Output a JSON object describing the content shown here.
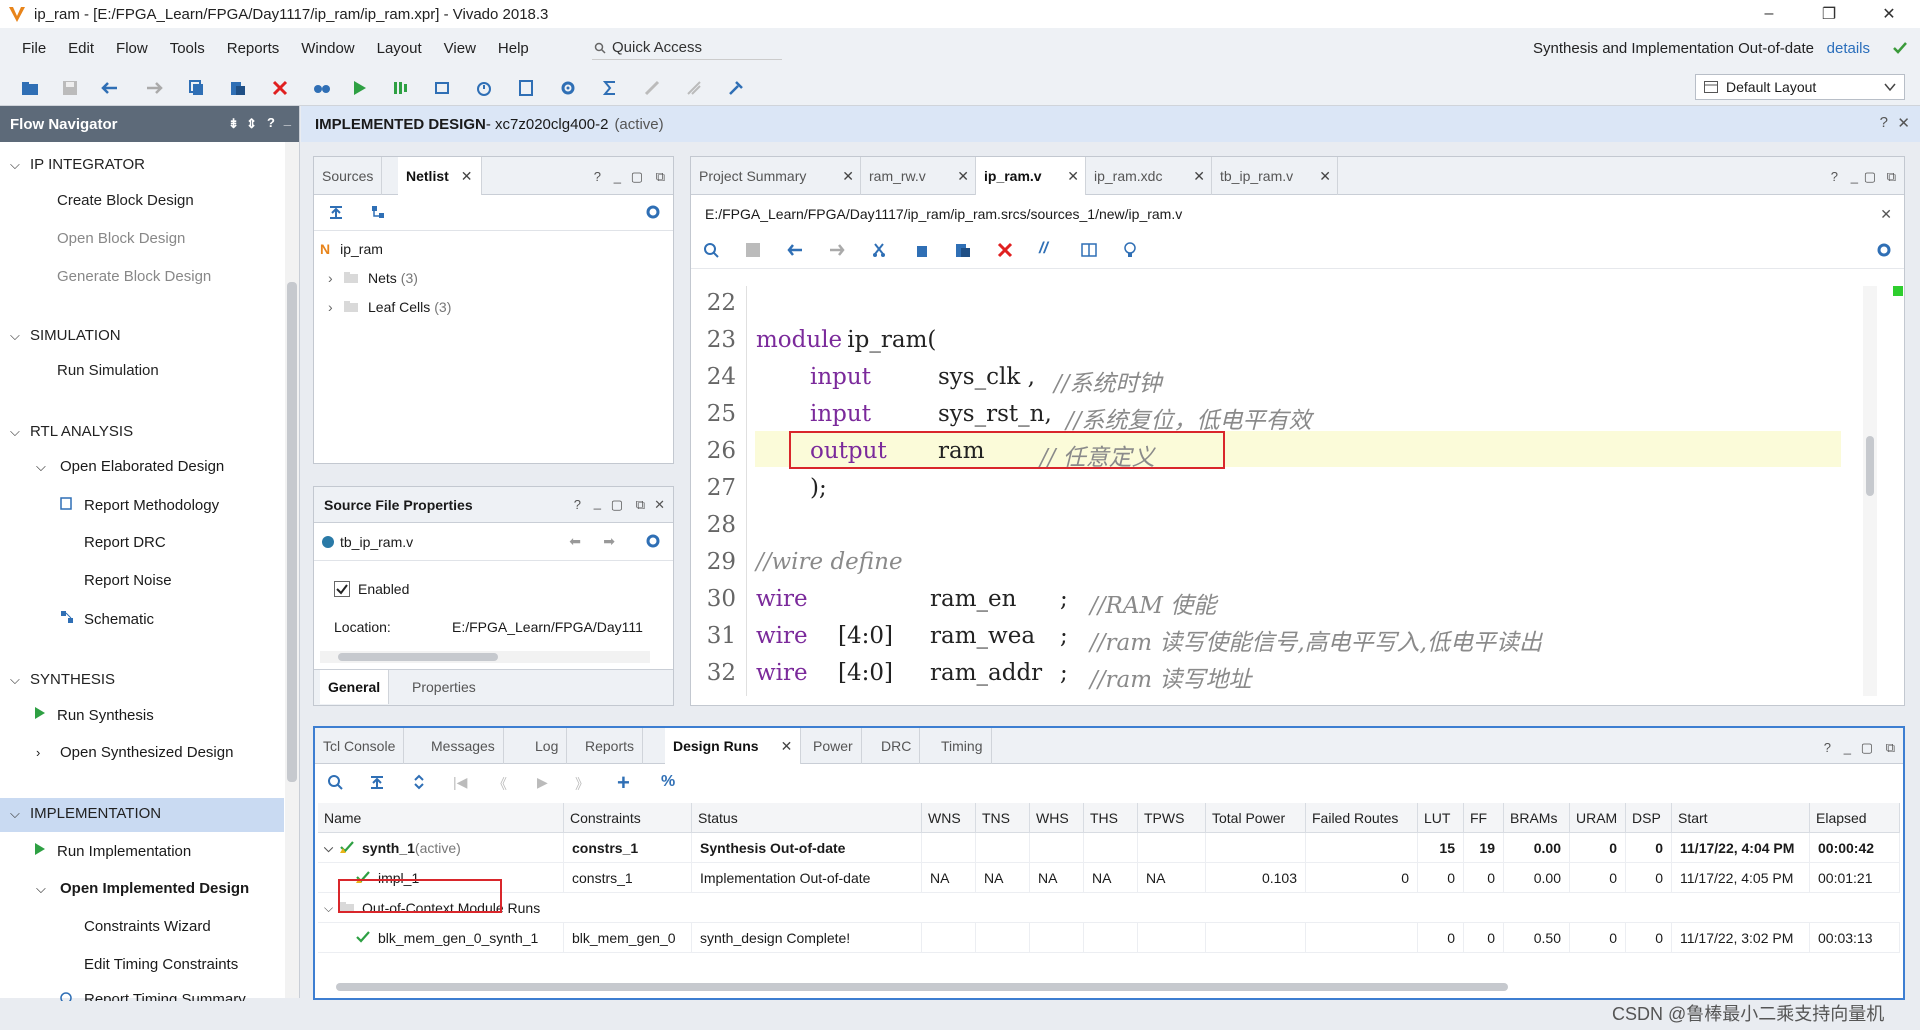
{
  "window": {
    "title": "ip_ram - [E:/FPGA_Learn/FPGA/Day1117/ip_ram/ip_ram.xpr] - Vivado 2018.3",
    "minimize": "–",
    "maximize": "❐",
    "close": "✕"
  },
  "menubar": {
    "items": [
      "File",
      "Edit",
      "Flow",
      "Tools",
      "Reports",
      "Window",
      "Layout",
      "View",
      "Help"
    ],
    "quick_access": "Quick Access",
    "status_text": "Synthesis and Implementation Out-of-date",
    "details": "details"
  },
  "toolbar": {
    "layout_select": "Default Layout"
  },
  "flow_navigator": {
    "title": "Flow Navigator",
    "sections": {
      "ip_integrator": "IP INTEGRATOR",
      "create_bd": "Create Block Design",
      "open_bd": "Open Block Design",
      "generate_bd": "Generate Block Design",
      "simulation": "SIMULATION",
      "run_sim": "Run Simulation",
      "rtl": "RTL ANALYSIS",
      "open_elab": "Open Elaborated Design",
      "report_meth": "Report Methodology",
      "report_drc": "Report DRC",
      "report_noise": "Report Noise",
      "schematic": "Schematic",
      "synthesis": "SYNTHESIS",
      "run_synth": "Run Synthesis",
      "open_synth": "Open Synthesized Design",
      "implementation": "IMPLEMENTATION",
      "run_impl": "Run Implementation",
      "open_impl": "Open Implemented Design",
      "constraints_wizard": "Constraints Wizard",
      "edit_timing": "Edit Timing Constraints",
      "report_timing": "Report Timing Summary"
    }
  },
  "main_header": {
    "title": "IMPLEMENTED DESIGN",
    "part": " - xc7z020clg400-2",
    "state": "(active)"
  },
  "sources_panel": {
    "tabs": [
      "Sources",
      "Netlist"
    ],
    "root": "ip_ram",
    "nets": "Nets",
    "nets_count": "(3)",
    "leaf_cells": "Leaf Cells",
    "leaf_count": "(3)"
  },
  "source_props": {
    "title": "Source File Properties",
    "file": "tb_ip_ram.v",
    "enabled": "Enabled",
    "location_label": "Location:",
    "location_value": "E:/FPGA_Learn/FPGA/Day111",
    "tabs": [
      "General",
      "Properties"
    ]
  },
  "editor": {
    "tabs": [
      "Project Summary",
      "ram_rw.v",
      "ip_ram.v",
      "ip_ram.xdc",
      "tb_ip_ram.v"
    ],
    "path": "E:/FPGA_Learn/FPGA/Day1117/ip_ram/ip_ram.srcs/sources_1/new/ip_ram.v",
    "lines": [
      {
        "n": "22",
        "kw": "",
        "id": "",
        "cm": ""
      },
      {
        "n": "23",
        "kw": "module",
        "id": " ip_ram(",
        "cm": ""
      },
      {
        "n": "24",
        "kw": "input",
        "id": "sys_clk ,",
        "cm": "//系统时钟"
      },
      {
        "n": "25",
        "kw": "input",
        "id": "sys_rst_n,",
        "cm": "//系统复位，低电平有效"
      },
      {
        "n": "26",
        "kw": "output",
        "id": "ram",
        "cm": "// 任意定义"
      },
      {
        "n": "27",
        "kw": "",
        "id": ");",
        "cm": ""
      },
      {
        "n": "28",
        "kw": "",
        "id": "",
        "cm": ""
      },
      {
        "n": "29",
        "kw": "",
        "id": "",
        "cm": "//wire define"
      },
      {
        "n": "30",
        "kw": "wire",
        "id": "ram_en",
        "cm": "//RAM 使能",
        "semi": ";",
        "w": ""
      },
      {
        "n": "31",
        "kw": "wire",
        "id": "ram_wea",
        "cm": "//ram 读写使能信号,高电平写入,低电平读出",
        "semi": ";",
        "w": "[4:0]"
      },
      {
        "n": "32",
        "kw": "wire",
        "id": "ram_addr",
        "cm": "//ram 读写地址",
        "semi": ";",
        "w": "[4:0]"
      }
    ]
  },
  "bottom": {
    "tabs": [
      "Tcl Console",
      "Messages",
      "Log",
      "Reports",
      "Design Runs",
      "Power",
      "DRC",
      "Timing"
    ],
    "columns": [
      "Name",
      "Constraints",
      "Status",
      "WNS",
      "TNS",
      "WHS",
      "THS",
      "TPWS",
      "Total Power",
      "Failed Routes",
      "LUT",
      "FF",
      "BRAMs",
      "URAM",
      "DSP",
      "Start",
      "Elapsed"
    ],
    "rows": [
      {
        "name": "synth_1",
        "extra": " (active)",
        "constraints": "constrs_1",
        "status": "Synthesis Out-of-date",
        "wns": "",
        "tns": "",
        "whs": "",
        "ths": "",
        "tpws": "",
        "power": "",
        "routes": "",
        "lut": "15",
        "ff": "19",
        "brams": "0.00",
        "uram": "0",
        "dsp": "0",
        "start": "11/17/22, 4:04 PM",
        "elapsed": "00:00:42"
      },
      {
        "name": "impl_1",
        "extra": "",
        "constraints": "constrs_1",
        "status": "Implementation Out-of-date",
        "wns": "NA",
        "tns": "NA",
        "whs": "NA",
        "ths": "NA",
        "tpws": "NA",
        "power": "0.103",
        "routes": "0",
        "lut": "0",
        "ff": "0",
        "brams": "0.00",
        "uram": "0",
        "dsp": "0",
        "start": "11/17/22, 4:05 PM",
        "elapsed": "00:01:21"
      },
      {
        "name": "Out-of-Context Module Runs",
        "extra": "",
        "constraints": "",
        "status": "",
        "wns": "",
        "tns": "",
        "whs": "",
        "ths": "",
        "tpws": "",
        "power": "",
        "routes": "",
        "lut": "",
        "ff": "",
        "brams": "",
        "uram": "",
        "dsp": "",
        "start": "",
        "elapsed": ""
      },
      {
        "name": "blk_mem_gen_0_synth_1",
        "extra": "",
        "constraints": "blk_mem_gen_0",
        "status": "synth_design Complete!",
        "wns": "",
        "tns": "",
        "whs": "",
        "ths": "",
        "tpws": "",
        "power": "",
        "routes": "",
        "lut": "0",
        "ff": "0",
        "brams": "0.50",
        "uram": "0",
        "dsp": "0",
        "start": "11/17/22, 3:02 PM",
        "elapsed": "00:03:13"
      }
    ]
  },
  "watermark": "CSDN @鲁棒最小二乘支持向量机",
  "colors": {
    "accent": "#2a6ebb",
    "keyword": "#7b2a9b",
    "comment": "#8a8a8a",
    "highlight_box": "#d9262b",
    "run_green": "#2ea043"
  }
}
